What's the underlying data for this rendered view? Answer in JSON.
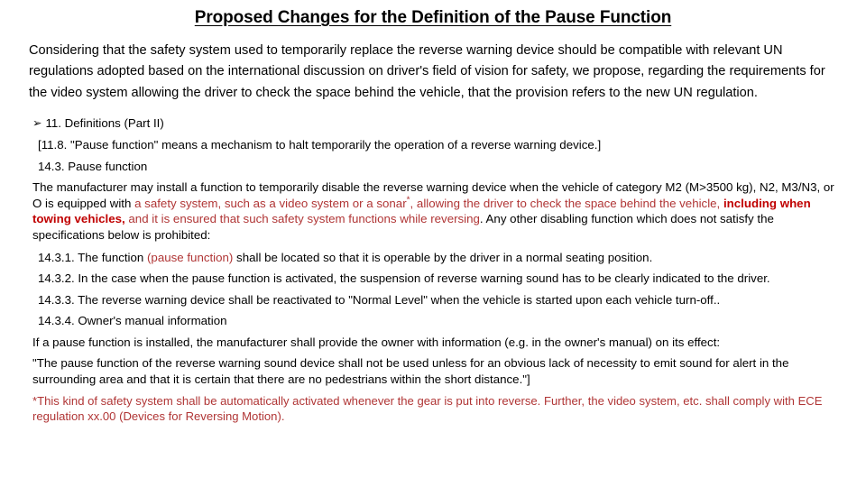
{
  "slide": {
    "title": "Proposed Changes for the Definition of the Pause Function",
    "intro": "Considering that the safety system used to temporarily replace the reverse warning device should be compatible with relevant UN regulations adopted based on the international discussion on driver's field of vision for safety, we propose, regarding the requirements for the video system allowing the driver to check the space behind the vehicle, that the provision refers to the new UN regulation.",
    "bullet_glyph": "➢",
    "bullet_heading": "11. Definitions (Part II)",
    "definition_line": "[11.8. \"Pause function\" means a mechanism to halt temporarily the operation of a reverse warning device.]",
    "clause_heading": "14.3. Pause function",
    "main_clause": {
      "seg1_black": "The manufacturer may install a function to temporarily disable the reverse warning device when the vehicle of category M2 (M>3500 kg), N2, M3/N3, or O is equipped with ",
      "seg2_red": "a safety system, such as a video system or a sonar",
      "seg2_superscript": "*",
      "seg3_red": ", allowing the driver to check the space behind the vehicle, ",
      "seg4_red_bold": "including when towing vehicles,",
      "seg5_red": " and it is ensured that such safety system functions while reversing",
      "seg6_black": ". Any other disabling function which does not satisfy the specifications below is prohibited:"
    },
    "clause_14_3_1": {
      "seg1_black": "14.3.1. The function ",
      "seg2_red": "(pause function)",
      "seg3_black": " shall be located so that it is operable by the driver in a normal seating position."
    },
    "clause_14_3_2": "14.3.2. In the case when the pause function is activated, the suspension of reverse warning sound has to be clearly indicated to the driver.",
    "clause_14_3_3": "14.3.3. The reverse warning device shall be reactivated to \"Normal Level\" when the vehicle is started upon each vehicle turn-off..",
    "clause_14_3_4": "14.3.4. Owner's manual information",
    "manual_info": "If a pause function is installed, the manufacturer shall provide the owner with information (e.g. in the owner's manual) on its effect:",
    "quoted_text": "\"The pause function of the reverse warning sound device shall not be used unless for an obvious lack of necessity to emit sound for alert in the surrounding area and that it is certain that there are no pedestrians within the short distance.\"]",
    "footnote": "*This kind of safety system shall be automatically activated whenever the gear is put into reverse. Further, the video system, etc. shall comply with ECE regulation xx.00 (Devices for Reversing Motion).",
    "colors": {
      "red": "#b03535",
      "red_bold": "#c00000",
      "text": "#000000",
      "background": "#ffffff"
    }
  }
}
